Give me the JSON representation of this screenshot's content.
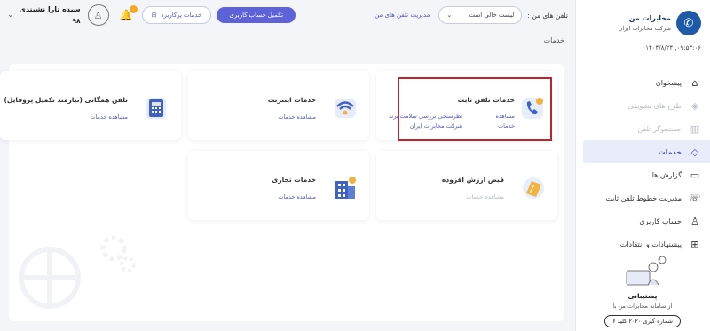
{
  "sidebar": {
    "brand_name": "مخابرات من",
    "brand_company": "شرکت مخابرات ایران",
    "brand_glyph": "✆",
    "datetime": "۱۴۰۴/۸/۲۴ ,۰۹:۵۳:۰۶",
    "items": [
      {
        "label": "پیشخوان",
        "icon": "home-icon",
        "glyph": "⌂"
      },
      {
        "label": "طرح های تشویقی",
        "icon": "gift-icon",
        "glyph": "◈"
      },
      {
        "label": "جستجوگر تلفن",
        "icon": "barcode-icon",
        "glyph": "▥"
      },
      {
        "label": "خدمات",
        "icon": "layers-icon",
        "glyph": "◇"
      },
      {
        "label": "گزارش ها",
        "icon": "report-icon",
        "glyph": "▭"
      },
      {
        "label": "مدیریت خطوط تلفن ثابت",
        "icon": "phone-line-icon",
        "glyph": "☏"
      },
      {
        "label": "حساب کاربری",
        "icon": "user-icon",
        "glyph": "♙"
      },
      {
        "label": "پیشنهادات و انتقادات",
        "icon": "feedback-icon",
        "glyph": "⊞"
      }
    ],
    "support_title": "پشتیبانی",
    "support_subtitle": "از سامانه مخابرات من با",
    "support_dial": "شماره گیری ۲۰۲۰ کلید ۶",
    "support_help_glyph": "?"
  },
  "topbar": {
    "lines_label": "تلفن های من :",
    "select_value": "لیست خالی است",
    "select_chevron": "⌄",
    "manage_lines_link": "مدیریت تلفن های من",
    "complete_account_button": "تکمیل حساب کاربری",
    "services_button": "خدمات پرکاربرد",
    "services_button_glyph": "⊞",
    "bell_glyph": "🔔",
    "notification_count": "۰",
    "avatar_glyph": "♙",
    "user_name": "سیده تارا نشیندی",
    "user_code": "۹۸",
    "dropdown_glyph": "⌄"
  },
  "page": {
    "title": "خدمات"
  },
  "cards": [
    {
      "title": "خدمات تلفن ثابت",
      "link": "مشاهده خدمات",
      "extra_line1": "نظرسنجی بررسی سلامت برند",
      "extra_line2": "شرکت مخابرات ایران"
    },
    {
      "title": "خدمات اینترنت",
      "link": "مشاهده خدمات"
    },
    {
      "title": "تلفن همگانی (نیازمند تکمیل پروفایل)",
      "link": "مشاهده خدمات"
    },
    {
      "title": "قبض ارزش افزوده",
      "link": "مشاهده خدمات"
    },
    {
      "title": "خدمات تجاری",
      "link": "مشاهده خدمات"
    }
  ],
  "colors": {
    "accent": "#5d62d8",
    "highlight": "#c0242b",
    "brand": "#1f5aa8"
  }
}
